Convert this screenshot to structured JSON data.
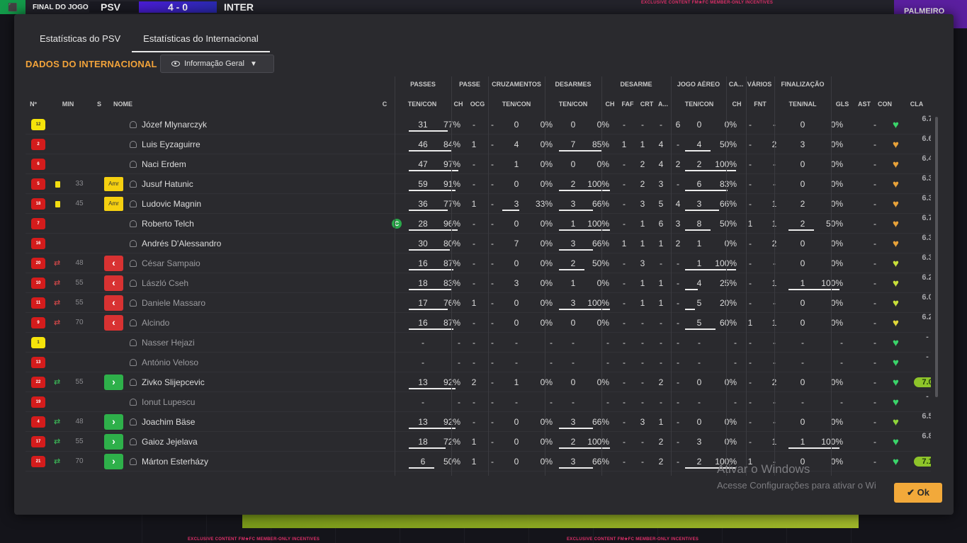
{
  "topbar": {
    "label": "FINAL DO JOGO",
    "home": "PSV",
    "score": "4 - 0",
    "away": "INTER",
    "right_label": "PALMEIRO"
  },
  "ad_text": "EXCLUSIVE CONTENT  FM★FC  MEMBER-ONLY INCENTIVES",
  "tabs": [
    "Estatísticas do PSV",
    "Estatísticas do Internacional"
  ],
  "section_title": "DADOS DO INTERNACIONAL",
  "view_dropdown": "Informação Geral",
  "groups": [
    "PASSES",
    "PASSE",
    "CRUZAMENTOS",
    "DESARMES",
    "DESARME",
    "JOGO AÉREO",
    "CA...",
    "VÁRIOS",
    "FINALIZAÇÃO"
  ],
  "headers": [
    "Nº",
    "MIN",
    "S",
    "NOME",
    "C",
    "TEN/CON",
    "CH",
    "OCG",
    "TEN/CON",
    "TEN/CON",
    "CH",
    "FAF",
    "CRT",
    "A...",
    "TEN/CON",
    "CH",
    "FNT",
    "TEN/NAL",
    "GLS",
    "AST",
    "CON",
    "CLA"
  ],
  "players": [
    {
      "num": "12",
      "shirt": "yel",
      "card": "",
      "min": "",
      "s": "",
      "name": "Józef Mlynarczyk",
      "cap": "",
      "pa": "31",
      "pp": "77%",
      "pf": 0.77,
      "pch": "-",
      "pog": "-",
      "ca": "0",
      "cp": "0%",
      "cf": 0,
      "da": "0",
      "dp": "0%",
      "df": 0,
      "dch": "-",
      "faf": "-",
      "crt": "-",
      "dao": "6",
      "aa": "0",
      "ap": "0%",
      "af": 0,
      "cach": "-",
      "fnt": "-",
      "fa": "0",
      "fp": "0%",
      "ff": 0,
      "gls": "",
      "ast": "-",
      "con": "#3ad46a",
      "cla": "6.7",
      "clahi": false,
      "dim": false
    },
    {
      "num": "2",
      "shirt": "red",
      "card": "",
      "min": "",
      "s": "",
      "name": "Luis Eyzaguirre",
      "cap": "",
      "pa": "46",
      "pp": "84%",
      "pf": 0.84,
      "pch": "1",
      "pog": "-",
      "ca": "4",
      "cp": "0%",
      "cf": 0,
      "da": "7",
      "dp": "85%",
      "df": 0.85,
      "dch": "1",
      "faf": "1",
      "crt": "4",
      "dao": "-",
      "aa": "4",
      "ap": "50%",
      "af": 0.5,
      "cach": "-",
      "fnt": "2",
      "fa": "3",
      "fp": "0%",
      "ff": 0,
      "gls": "",
      "ast": "-",
      "con": "#e8a23a",
      "cla": "6.6",
      "clahi": false,
      "dim": false
    },
    {
      "num": "6",
      "shirt": "red",
      "card": "",
      "min": "",
      "s": "",
      "name": "Naci Erdem",
      "cap": "",
      "pa": "47",
      "pp": "97%",
      "pf": 0.97,
      "pch": "-",
      "pog": "-",
      "ca": "1",
      "cp": "0%",
      "cf": 0,
      "da": "0",
      "dp": "0%",
      "df": 0,
      "dch": "-",
      "faf": "2",
      "crt": "4",
      "dao": "2",
      "aa": "2",
      "ap": "100%",
      "af": 1,
      "cach": "-",
      "fnt": "-",
      "fa": "0",
      "fp": "0%",
      "ff": 0,
      "gls": "",
      "ast": "-",
      "con": "#e8a23a",
      "cla": "6.4",
      "clahi": false,
      "dim": false
    },
    {
      "num": "5",
      "shirt": "red",
      "card": "y",
      "min": "33",
      "s": "amr",
      "name": "Jusuf Hatunic",
      "cap": "",
      "pa": "59",
      "pp": "91%",
      "pf": 0.91,
      "pch": "-",
      "pog": "-",
      "ca": "0",
      "cp": "0%",
      "cf": 0,
      "da": "2",
      "dp": "100%",
      "df": 1,
      "dch": "-",
      "faf": "2",
      "crt": "3",
      "dao": "-",
      "aa": "6",
      "ap": "83%",
      "af": 0.83,
      "cach": "-",
      "fnt": "-",
      "fa": "0",
      "fp": "0%",
      "ff": 0,
      "gls": "",
      "ast": "-",
      "con": "#e8a23a",
      "cla": "6.3",
      "clahi": false,
      "dim": false
    },
    {
      "num": "18",
      "shirt": "red",
      "card": "y",
      "min": "45",
      "s": "amr",
      "name": "Ludovic Magnin",
      "cap": "",
      "pa": "36",
      "pp": "77%",
      "pf": 0.77,
      "pch": "1",
      "pog": "-",
      "ca": "3",
      "cp": "33%",
      "cf": 0.33,
      "da": "3",
      "dp": "66%",
      "df": 0.66,
      "dch": "-",
      "faf": "3",
      "crt": "5",
      "dao": "4",
      "aa": "3",
      "ap": "66%",
      "af": 0.66,
      "cach": "-",
      "fnt": "1",
      "fa": "2",
      "fp": "0%",
      "ff": 0,
      "gls": "",
      "ast": "-",
      "con": "#e8a23a",
      "cla": "6.3",
      "clahi": false,
      "dim": false
    },
    {
      "num": "7",
      "shirt": "red",
      "card": "",
      "min": "",
      "s": "",
      "name": "Roberto Telch",
      "cap": "C",
      "pa": "28",
      "pp": "96%",
      "pf": 0.96,
      "pch": "-",
      "pog": "-",
      "ca": "0",
      "cp": "0%",
      "cf": 0,
      "da": "1",
      "dp": "100%",
      "df": 1,
      "dch": "-",
      "faf": "1",
      "crt": "6",
      "dao": "3",
      "aa": "8",
      "ap": "50%",
      "af": 0.5,
      "cach": "1",
      "fnt": "1",
      "fa": "2",
      "fp": "50%",
      "ff": 0.5,
      "gls": "",
      "ast": "-",
      "con": "#e8a23a",
      "cla": "6.7",
      "clahi": false,
      "dim": false
    },
    {
      "num": "16",
      "shirt": "red",
      "card": "",
      "min": "",
      "s": "",
      "name": "Andrés D'Alessandro",
      "cap": "",
      "pa": "30",
      "pp": "80%",
      "pf": 0.8,
      "pch": "-",
      "pog": "-",
      "ca": "7",
      "cp": "0%",
      "cf": 0,
      "da": "3",
      "dp": "66%",
      "df": 0.66,
      "dch": "1",
      "faf": "1",
      "crt": "1",
      "dao": "2",
      "aa": "1",
      "ap": "0%",
      "af": 0,
      "cach": "-",
      "fnt": "2",
      "fa": "0",
      "fp": "0%",
      "ff": 0,
      "gls": "",
      "ast": "-",
      "con": "#e8a23a",
      "cla": "6.3",
      "clahi": false,
      "dim": false
    },
    {
      "num": "20",
      "shirt": "red",
      "card": "",
      "min": "48",
      "s": "out",
      "name": "César Sampaio",
      "cap": "",
      "pa": "16",
      "pp": "87%",
      "pf": 0.87,
      "pch": "-",
      "pog": "-",
      "ca": "0",
      "cp": "0%",
      "cf": 0,
      "da": "2",
      "dp": "50%",
      "df": 0.5,
      "dch": "-",
      "faf": "3",
      "crt": "-",
      "dao": "-",
      "aa": "1",
      "ap": "100%",
      "af": 1,
      "cach": "-",
      "fnt": "-",
      "fa": "0",
      "fp": "0%",
      "ff": 0,
      "gls": "",
      "ast": "-",
      "con": "#c8e03a",
      "cla": "6.3",
      "clahi": false,
      "dim": true
    },
    {
      "num": "10",
      "shirt": "red",
      "card": "",
      "min": "55",
      "s": "out",
      "name": "László Cseh",
      "cap": "",
      "pa": "18",
      "pp": "83%",
      "pf": 0.83,
      "pch": "-",
      "pog": "-",
      "ca": "3",
      "cp": "0%",
      "cf": 0,
      "da": "1",
      "dp": "0%",
      "df": 0,
      "dch": "-",
      "faf": "1",
      "crt": "1",
      "dao": "-",
      "aa": "4",
      "ap": "25%",
      "af": 0.25,
      "cach": "-",
      "fnt": "1",
      "fa": "1",
      "fp": "100%",
      "ff": 1,
      "gls": "",
      "ast": "-",
      "con": "#c8e03a",
      "cla": "6.2",
      "clahi": false,
      "dim": true
    },
    {
      "num": "11",
      "shirt": "red",
      "card": "",
      "min": "55",
      "s": "out",
      "name": "Daniele Massaro",
      "cap": "",
      "pa": "17",
      "pp": "76%",
      "pf": 0.76,
      "pch": "1",
      "pog": "-",
      "ca": "0",
      "cp": "0%",
      "cf": 0,
      "da": "3",
      "dp": "100%",
      "df": 1,
      "dch": "-",
      "faf": "1",
      "crt": "1",
      "dao": "-",
      "aa": "5",
      "ap": "20%",
      "af": 0.2,
      "cach": "-",
      "fnt": "-",
      "fa": "0",
      "fp": "0%",
      "ff": 0,
      "gls": "",
      "ast": "-",
      "con": "#c8e03a",
      "cla": "6.0",
      "clahi": false,
      "dim": true
    },
    {
      "num": "9",
      "shirt": "red",
      "card": "",
      "min": "70",
      "s": "out",
      "name": "Alcindo",
      "cap": "",
      "pa": "16",
      "pp": "87%",
      "pf": 0.87,
      "pch": "-",
      "pog": "-",
      "ca": "0",
      "cp": "0%",
      "cf": 0,
      "da": "0",
      "dp": "0%",
      "df": 0,
      "dch": "-",
      "faf": "-",
      "crt": "-",
      "dao": "-",
      "aa": "5",
      "ap": "60%",
      "af": 0.6,
      "cach": "1",
      "fnt": "1",
      "fa": "0",
      "fp": "0%",
      "ff": 0,
      "gls": "",
      "ast": "-",
      "con": "#e0d83a",
      "cla": "6.2",
      "clahi": false,
      "dim": true
    },
    {
      "num": "1",
      "shirt": "yel",
      "card": "",
      "min": "",
      "s": "",
      "name": "Nasser Hejazi",
      "cap": "",
      "pa": "-",
      "pp": "-",
      "pf": -1,
      "pch": "-",
      "pog": "-",
      "ca": "-",
      "cp": "-",
      "cf": -1,
      "da": "-",
      "dp": "-",
      "df": -1,
      "dch": "-",
      "faf": "-",
      "crt": "-",
      "dao": "-",
      "aa": "-",
      "ap": "-",
      "af": -1,
      "cach": "-",
      "fnt": "-",
      "fa": "-",
      "fp": "-",
      "ff": -1,
      "gls": "",
      "ast": "-",
      "con": "#3ad46a",
      "cla": "-",
      "clahi": false,
      "dim": true
    },
    {
      "num": "13",
      "shirt": "red",
      "card": "",
      "min": "",
      "s": "",
      "name": "António Veloso",
      "cap": "",
      "pa": "-",
      "pp": "-",
      "pf": -1,
      "pch": "-",
      "pog": "-",
      "ca": "-",
      "cp": "-",
      "cf": -1,
      "da": "-",
      "dp": "-",
      "df": -1,
      "dch": "-",
      "faf": "-",
      "crt": "-",
      "dao": "-",
      "aa": "-",
      "ap": "-",
      "af": -1,
      "cach": "-",
      "fnt": "-",
      "fa": "-",
      "fp": "-",
      "ff": -1,
      "gls": "",
      "ast": "-",
      "con": "#3ad46a",
      "cla": "-",
      "clahi": false,
      "dim": true
    },
    {
      "num": "22",
      "shirt": "red",
      "card": "",
      "min": "55",
      "s": "in",
      "name": "Zivko Slijepcevic",
      "cap": "",
      "pa": "13",
      "pp": "92%",
      "pf": 0.92,
      "pch": "2",
      "pog": "-",
      "ca": "1",
      "cp": "0%",
      "cf": 0,
      "da": "0",
      "dp": "0%",
      "df": 0,
      "dch": "-",
      "faf": "-",
      "crt": "2",
      "dao": "-",
      "aa": "0",
      "ap": "0%",
      "af": 0,
      "cach": "-",
      "fnt": "2",
      "fa": "0",
      "fp": "0%",
      "ff": 0,
      "gls": "",
      "ast": "-",
      "con": "#3ad46a",
      "cla": "7.0",
      "clahi": true,
      "dim": false
    },
    {
      "num": "19",
      "shirt": "red",
      "card": "",
      "min": "",
      "s": "",
      "name": "Ionut Lupescu",
      "cap": "",
      "pa": "-",
      "pp": "-",
      "pf": -1,
      "pch": "-",
      "pog": "-",
      "ca": "-",
      "cp": "-",
      "cf": -1,
      "da": "-",
      "dp": "-",
      "df": -1,
      "dch": "-",
      "faf": "-",
      "crt": "-",
      "dao": "-",
      "aa": "-",
      "ap": "-",
      "af": -1,
      "cach": "-",
      "fnt": "-",
      "fa": "-",
      "fp": "-",
      "ff": -1,
      "gls": "",
      "ast": "-",
      "con": "#3ad46a",
      "cla": "-",
      "clahi": false,
      "dim": true
    },
    {
      "num": "4",
      "shirt": "red",
      "card": "",
      "min": "48",
      "s": "in",
      "name": "Joachim Bäse",
      "cap": "",
      "pa": "13",
      "pp": "92%",
      "pf": 0.92,
      "pch": "-",
      "pog": "-",
      "ca": "0",
      "cp": "0%",
      "cf": 0,
      "da": "3",
      "dp": "66%",
      "df": 0.66,
      "dch": "-",
      "faf": "3",
      "crt": "1",
      "dao": "-",
      "aa": "0",
      "ap": "0%",
      "af": 0,
      "cach": "-",
      "fnt": "-",
      "fa": "0",
      "fp": "0%",
      "ff": 0,
      "gls": "",
      "ast": "-",
      "con": "#8ed43a",
      "cla": "6.5",
      "clahi": false,
      "dim": false
    },
    {
      "num": "17",
      "shirt": "red",
      "card": "",
      "min": "55",
      "s": "in",
      "name": "Gaioz Jejelava",
      "cap": "",
      "pa": "18",
      "pp": "72%",
      "pf": 0.72,
      "pch": "1",
      "pog": "-",
      "ca": "0",
      "cp": "0%",
      "cf": 0,
      "da": "2",
      "dp": "100%",
      "df": 1,
      "dch": "-",
      "faf": "-",
      "crt": "2",
      "dao": "-",
      "aa": "3",
      "ap": "0%",
      "af": 0,
      "cach": "-",
      "fnt": "1",
      "fa": "1",
      "fp": "100%",
      "ff": 1,
      "gls": "",
      "ast": "-",
      "con": "#3ad46a",
      "cla": "6.8",
      "clahi": false,
      "dim": false
    },
    {
      "num": "21",
      "shirt": "red",
      "card": "",
      "min": "70",
      "s": "in",
      "name": "Márton Esterházy",
      "cap": "",
      "pa": "6",
      "pp": "50%",
      "pf": 0.5,
      "pch": "1",
      "pog": "-",
      "ca": "0",
      "cp": "0%",
      "cf": 0,
      "da": "3",
      "dp": "66%",
      "df": 0.66,
      "dch": "-",
      "faf": "-",
      "crt": "2",
      "dao": "-",
      "aa": "2",
      "ap": "100%",
      "af": 1,
      "cach": "1",
      "fnt": "-",
      "fa": "0",
      "fp": "0%",
      "ff": 0,
      "gls": "",
      "ast": "-",
      "con": "#3ad46a",
      "cla": "7.1",
      "clahi": true,
      "dim": false
    }
  ],
  "watermark": {
    "line1": "Ativar o Windows",
    "line2": "Acesse Configurações para ativar o Wi"
  },
  "ok_button": "Ok"
}
